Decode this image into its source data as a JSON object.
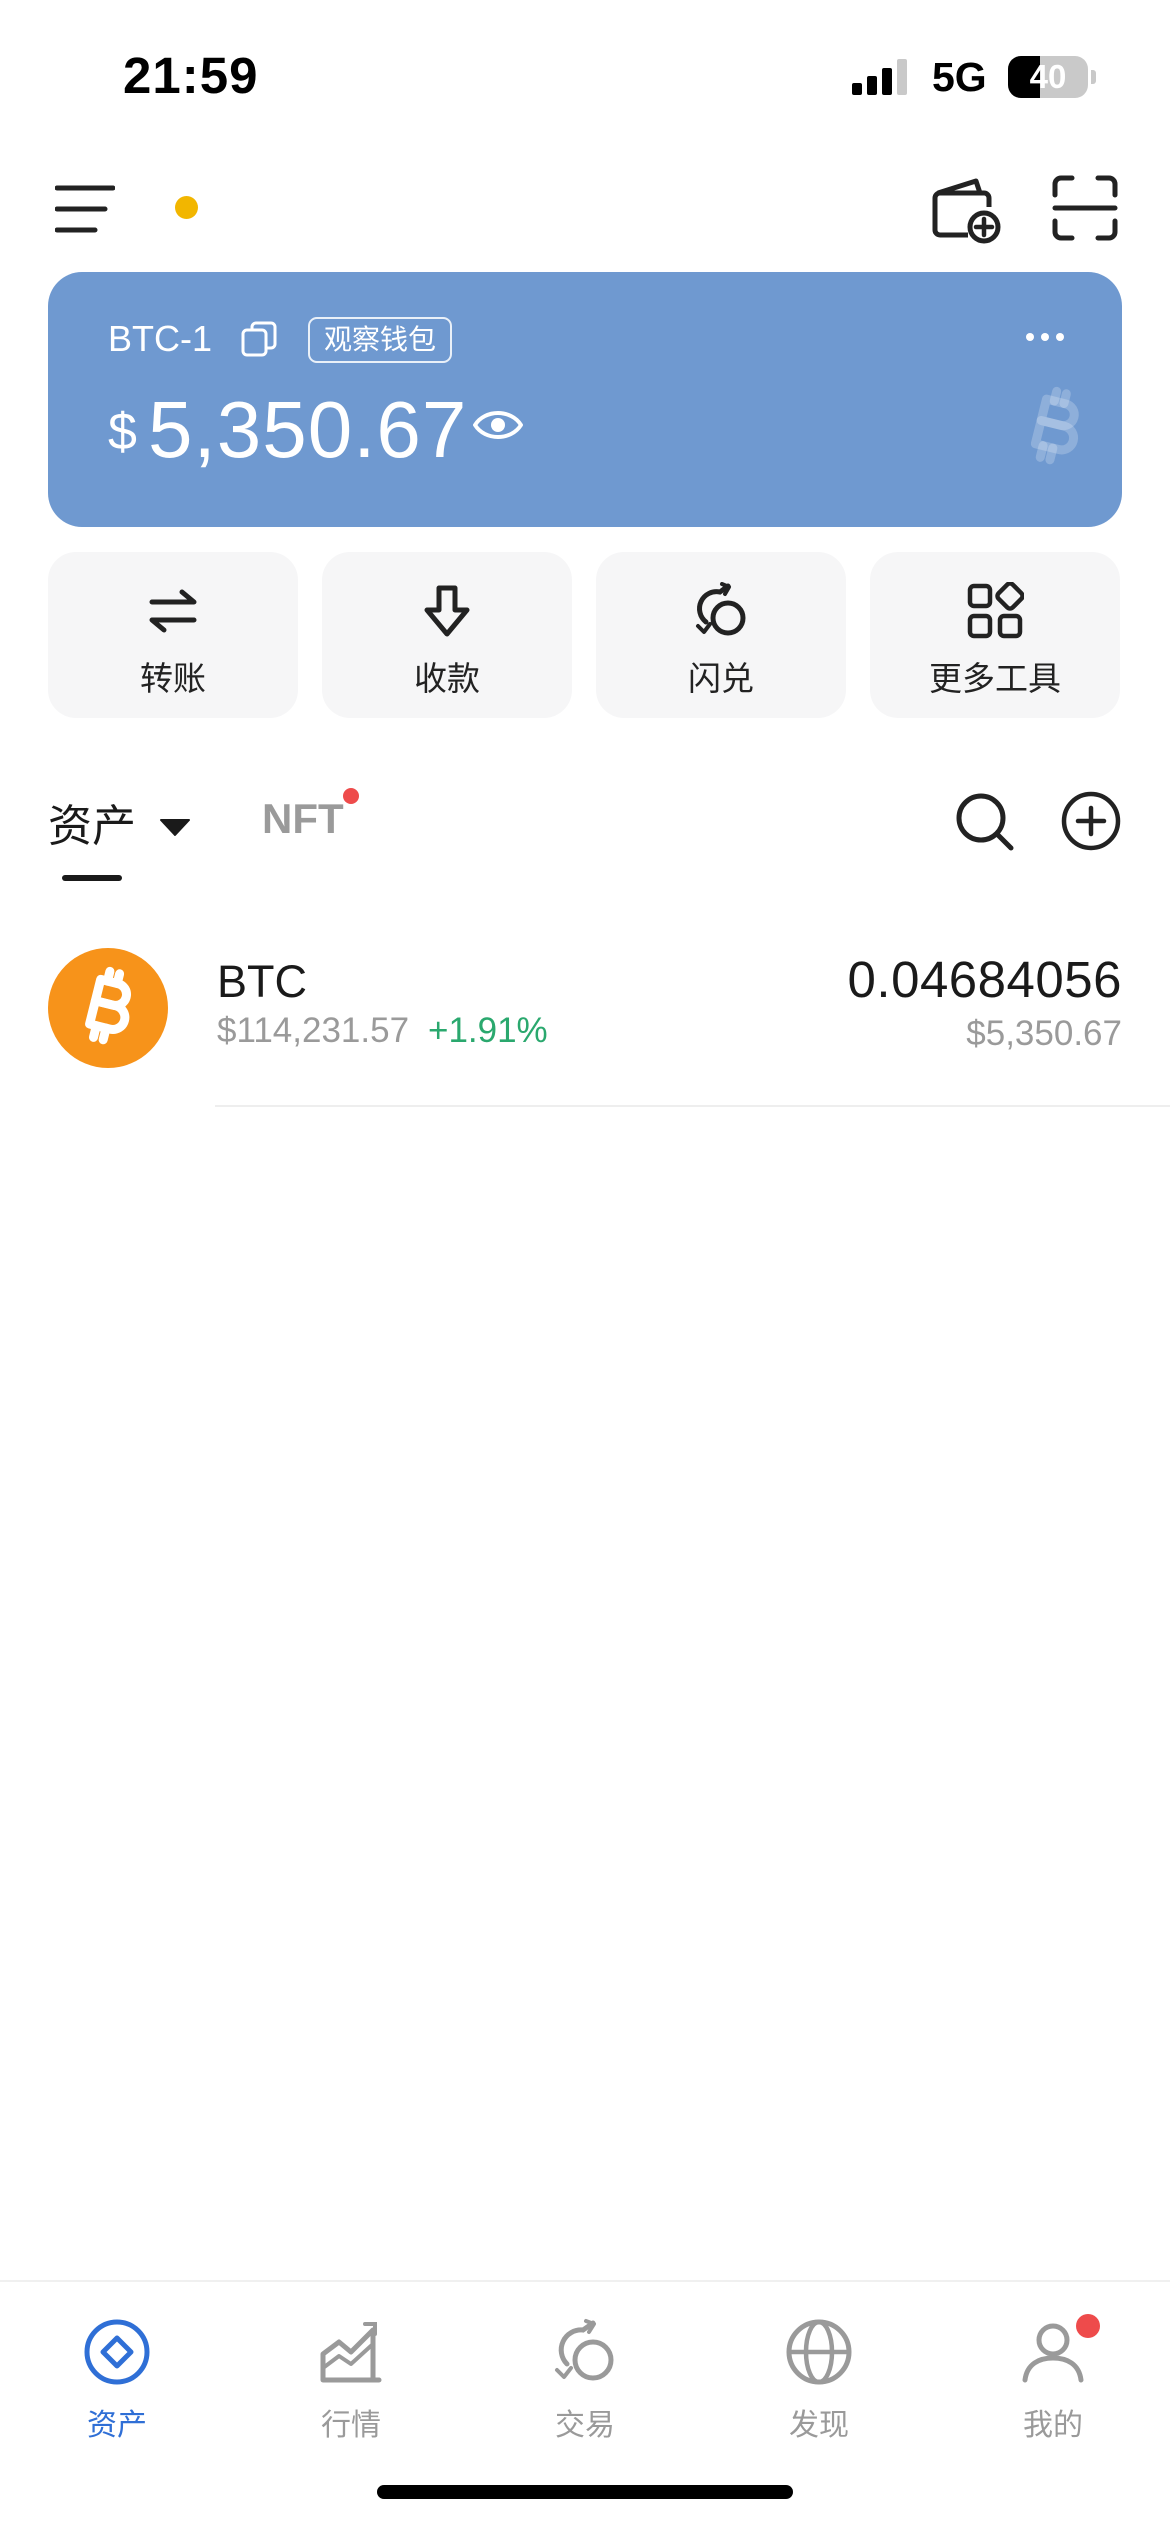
{
  "status_bar": {
    "time": "21:59",
    "network": "5G",
    "battery_level": "40",
    "battery_fraction": 0.4
  },
  "top_bar": {
    "menu_icon": "menu-icon",
    "wallet_add_icon": "wallet-add-icon",
    "scan_icon": "scan-icon",
    "notice_dot_color": "#f2b600"
  },
  "wallet": {
    "name": "BTC-1",
    "badge": "观察钱包",
    "currency_symbol": "$",
    "balance": "5,350.67",
    "card_color": "#6f99d0"
  },
  "actions": [
    {
      "label": "转账",
      "icon": "transfer-icon"
    },
    {
      "label": "收款",
      "icon": "receive-icon"
    },
    {
      "label": "闪兑",
      "icon": "swap-icon"
    },
    {
      "label": "更多工具",
      "icon": "more-tools-icon"
    }
  ],
  "tabs": {
    "assets": "资产",
    "nft": "NFT"
  },
  "tokens": [
    {
      "symbol": "BTC",
      "price": "$114,231.57",
      "change": "+1.91%",
      "amount": "0.04684056",
      "value": "$5,350.67",
      "icon": "bitcoin-icon"
    }
  ],
  "bottom_nav": [
    {
      "label": "资产",
      "icon": "assets-icon",
      "active": true
    },
    {
      "label": "行情",
      "icon": "market-icon",
      "active": false
    },
    {
      "label": "交易",
      "icon": "trade-icon",
      "active": false
    },
    {
      "label": "发现",
      "icon": "discover-icon",
      "active": false
    },
    {
      "label": "我的",
      "icon": "profile-icon",
      "active": false
    }
  ],
  "colors": {
    "accent": "#2f6fd6",
    "positive": "#2aa86e",
    "alert": "#ee4b4b",
    "bitcoin": "#f7931a"
  }
}
